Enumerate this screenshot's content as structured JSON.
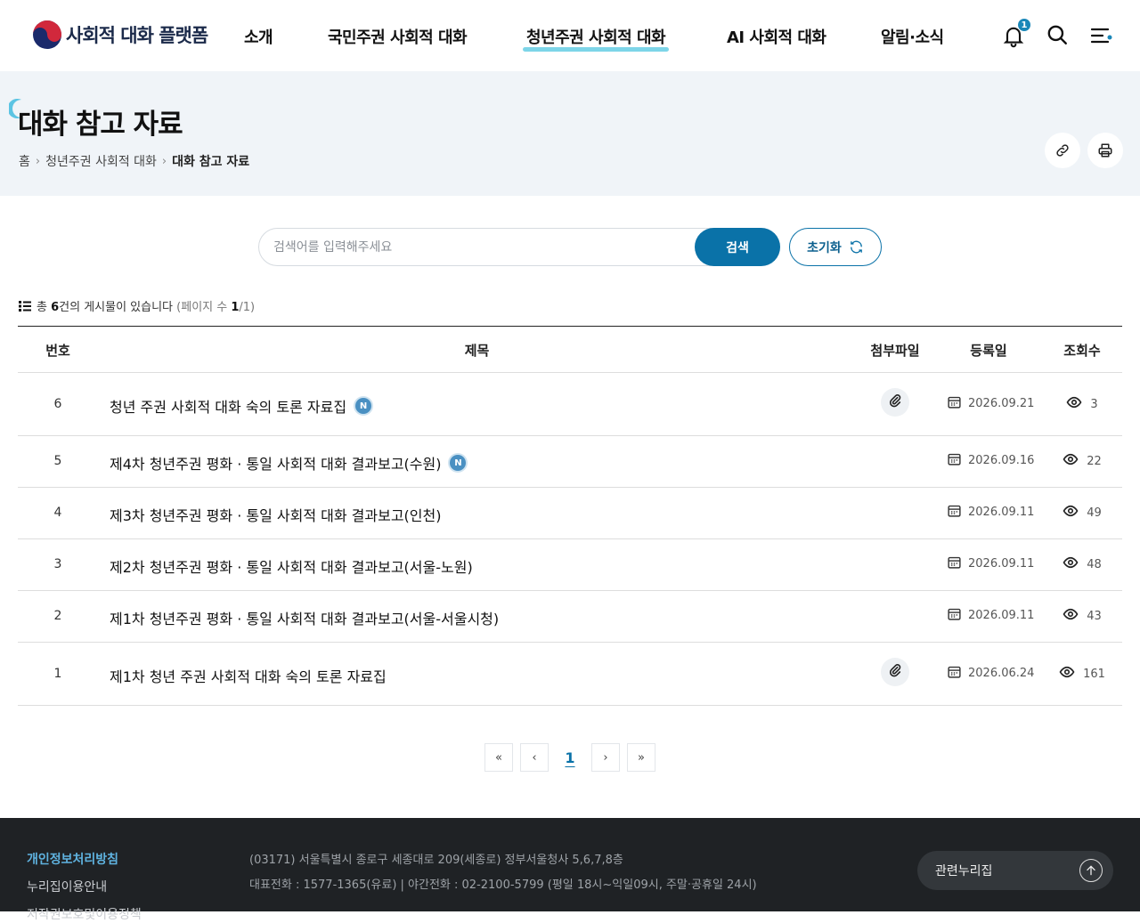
{
  "header": {
    "logo_text": "사회적 대화 플랫폼",
    "nav": [
      {
        "label": "소개"
      },
      {
        "label": "국민주권 사회적 대화"
      },
      {
        "label": "청년주권 사회적 대화",
        "active": true
      },
      {
        "label": "AI 사회적 대화"
      },
      {
        "label": "알림·소식"
      }
    ],
    "notification_count": "1",
    "icons": [
      "bell-icon",
      "search-icon",
      "menu-icon"
    ]
  },
  "title_band": {
    "title": "대화 참고 자료",
    "breadcrumb": [
      "홈",
      "청년주권 사회적 대화",
      "대화 참고 자료"
    ],
    "actions": [
      "link-icon",
      "print-icon"
    ]
  },
  "search": {
    "placeholder": "검색어를 입력해주세요",
    "value": "",
    "search_label": "검색",
    "reset_label": "초기화"
  },
  "count": {
    "prefix": "총",
    "total": "6",
    "suffix": "건의 게시물이 있습니다",
    "page_prefix": "(페이지 수",
    "page_current": "1",
    "page_suffix": "/1)"
  },
  "table": {
    "headers": {
      "no": "번호",
      "title": "제목",
      "attach": "첨부파일",
      "date": "등록일",
      "views": "조회수"
    },
    "rows": [
      {
        "no": "6",
        "title": "청년 주권 사회적 대화 숙의 토론 자료집",
        "new": "N",
        "attachment": true,
        "date": "2026.09.21",
        "views": "3"
      },
      {
        "no": "5",
        "title": "제4차 청년주권 평화 · 통일 사회적 대화 결과보고(수원)",
        "new": "N",
        "attachment": false,
        "date": "2026.09.16",
        "views": "22"
      },
      {
        "no": "4",
        "title": "제3차 청년주권 평화 · 통일 사회적 대화 결과보고(인천)",
        "new": "",
        "attachment": false,
        "date": "2026.09.11",
        "views": "49"
      },
      {
        "no": "3",
        "title": "제2차 청년주권 평화 · 통일 사회적 대화 결과보고(서울-노원)",
        "new": "",
        "attachment": false,
        "date": "2026.09.11",
        "views": "48"
      },
      {
        "no": "2",
        "title": "제1차 청년주권 평화 · 통일 사회적 대화 결과보고(서울-서울시청)",
        "new": "",
        "attachment": false,
        "date": "2026.09.11",
        "views": "43"
      },
      {
        "no": "1",
        "title": "제1차 청년 주권 사회적 대화 숙의 토론 자료집",
        "new": "",
        "attachment": true,
        "date": "2026.06.24",
        "views": "161"
      }
    ]
  },
  "pagination": {
    "first": "«",
    "prev": "‹",
    "current": "1",
    "next": "›",
    "last": "»"
  },
  "footer": {
    "links": [
      "개인정보처리방침",
      "누리집이용안내",
      "저작권보호및이용정책"
    ],
    "address": "(03171) 서울특별시 종로구 세종대로 209(세종로) 정부서울청사 5,6,7,8층",
    "phone": "대표전화 : 1577-1365(유료)  |  야간전화 : 02-2100-5799 (평일 18시~익일09시, 주말·공휴일 24시)",
    "related_label": "관련누리집"
  },
  "colors": {
    "accent": "#0a72a8",
    "active_underline": "#6fd0e6",
    "band": "#f0f4f8",
    "footer": "#1f2225"
  }
}
